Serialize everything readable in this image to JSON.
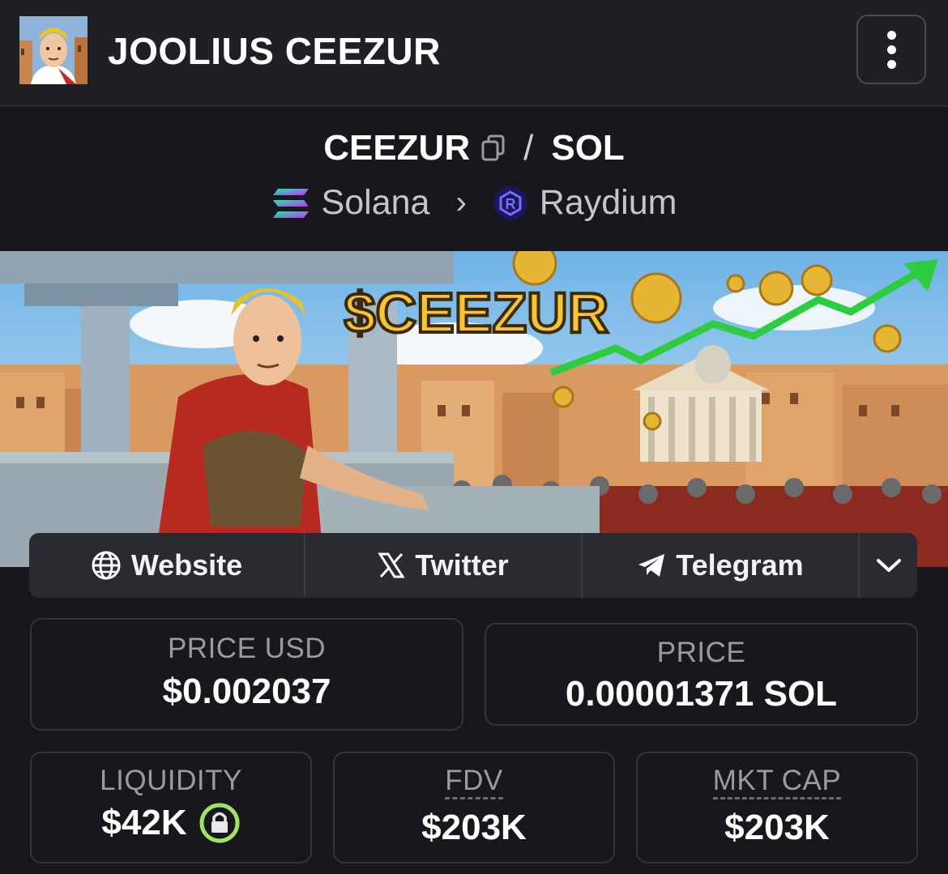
{
  "header": {
    "token_name": "JOOLIUS CEEZUR",
    "menu_icon": "vertical-dots-icon"
  },
  "pair": {
    "base": "CEEZUR",
    "separator": "/",
    "quote": "SOL",
    "chain": "Solana",
    "dex": "Raydium"
  },
  "banner": {
    "title": "$CEEZUR"
  },
  "social": {
    "website_label": "Website",
    "twitter_label": "Twitter",
    "telegram_label": "Telegram"
  },
  "stats": {
    "price_usd_label": "PRICE USD",
    "price_usd_value": "$0.002037",
    "price_label": "PRICE",
    "price_value": "0.00001371 SOL",
    "liquidity_label": "LIQUIDITY",
    "liquidity_value": "$42K",
    "fdv_label": "FDV",
    "fdv_value": "$203K",
    "mktcap_label": "MKT CAP",
    "mktcap_value": "$203K"
  },
  "colors": {
    "background": "#17171c",
    "header": "#1f2025",
    "social_bar": "#2a2b31",
    "lock_ring": "#a3e067",
    "arrow_green": "#2ecc40"
  }
}
